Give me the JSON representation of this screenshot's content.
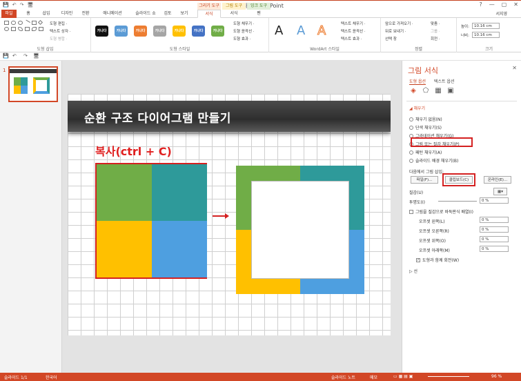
{
  "window": {
    "title": "강좌 - PowerPoint",
    "help": "?",
    "controls": [
      "—",
      "▢",
      "✕"
    ],
    "user": "서지영"
  },
  "qat_top": [
    "💾",
    "↶",
    "↷",
    "🖥"
  ],
  "context": {
    "draw_tools": "그리기 도구",
    "pic_tools": "그림 도구",
    "ink_tools": "잉크 도구"
  },
  "tabs": {
    "file": "파일",
    "home": "홈",
    "insert": "삽입",
    "design": "디자인",
    "transitions": "전환",
    "animations": "애니메이션",
    "slideshow": "슬라이드 쇼",
    "review": "검토",
    "view": "보기",
    "format1": "서식",
    "format2": "서식",
    "pen": "펜"
  },
  "ribbon": {
    "insert_shapes_label": "도형 삽입",
    "edit_shape": "도형 편집 ·",
    "text_box": "텍스트 상자 ·",
    "merge_shapes": "도형 병합 ·",
    "style_labels": [
      "가나다",
      "가나다",
      "가나다",
      "가나다",
      "가나다",
      "가나다",
      "가나다"
    ],
    "style_colors": [
      "#111111",
      "#5b9bd5",
      "#ed7d31",
      "#a5a5a5",
      "#ffc000",
      "#4472c4",
      "#70ad47"
    ],
    "shape_styles_label": "도형 스타일",
    "shape_fill": "도형 채우기 ·",
    "shape_outline": "도형 윤곽선 ·",
    "shape_effects": "도형 효과 ·",
    "wordart_letters": [
      "A",
      "A",
      "A"
    ],
    "text_fill": "텍스트 채우기 ·",
    "text_outline": "텍스트 윤곽선 ·",
    "text_effects": "텍스트 효과 ·",
    "wordart_label": "WordArt 스타일",
    "bring_forward": "앞으로 가져오기 ·",
    "send_backward": "뒤로 보내기 ·",
    "selection_pane": "선택 창",
    "align": "맞춤 ·",
    "group": "그룹 ·",
    "rotate": "회전 ·",
    "arrange_label": "정렬",
    "height_label": "높이:",
    "height_value": "10.16 cm",
    "width_label": "너비:",
    "width_value": "10.16 cm",
    "size_label": "크기"
  },
  "slide": {
    "number": "1",
    "title": "순환 구조 다이어그램 만들기",
    "copy_label": "복사(ctrl + C)"
  },
  "colors": {
    "green": "#70ad47",
    "teal": "#2e9a9a",
    "yellow": "#ffc000",
    "blue": "#4e9fe0",
    "accent": "#d24726",
    "highlight": "#d42020"
  },
  "panel": {
    "title": "그림 서식",
    "tab_shape": "도형 옵션",
    "tab_text": "텍스트 옵션",
    "fill_header": "◢ 채우기",
    "fill_options": [
      "채우기 없음(N)",
      "단색 채우기(S)",
      "그라데이션 채우기(G)",
      "그림 또는 질감 채우기(P)",
      "패턴 채우기(A)",
      "슬라이드 배경 채우기(B)"
    ],
    "insert_from": "다음에서 그림 삽입:",
    "btn_file": "파일(F)...",
    "btn_clipboard": "클립보드(C)",
    "btn_online": "온라인(E)...",
    "texture": "질감(U)",
    "transparency": "투명도(I)",
    "transparency_val": "0 %",
    "tile": "그림을 질감으로 바둑판식 배열(I)",
    "offsets": [
      {
        "label": "오프셋 왼쪽(L)",
        "val": "0 %"
      },
      {
        "label": "오프셋 오른쪽(R)",
        "val": "0 %"
      },
      {
        "label": "오프셋 위쪽(O)",
        "val": "0 %"
      },
      {
        "label": "오프셋 아래쪽(M)",
        "val": "0 %"
      }
    ],
    "rotate_with": "도형과 함께 회전(W)",
    "line_header": "▷ 선"
  },
  "status": {
    "slide": "슬라이드 1/1",
    "lang": "한국어",
    "notes": "슬라이드 노트",
    "comments": "메모",
    "zoom": "96 %"
  }
}
